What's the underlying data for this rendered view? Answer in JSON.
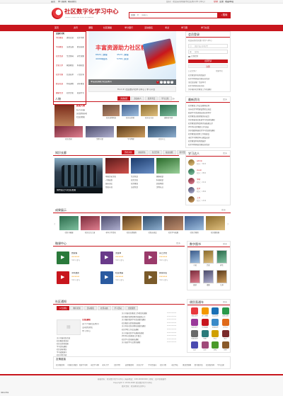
{
  "topbar": {
    "links": [
      "首页",
      "学习指南",
      "联系我们"
    ],
    "right": "您好！欢迎来到成都市社区教育学习中心！",
    "login": "登录",
    "register": "注册",
    "fav": "收藏本站"
  },
  "logo": {
    "title": "社区数字化学习中心",
    "sub": "SHEQU SHUZIHUA XUEXI ZHONGXIN"
  },
  "search": {
    "category": "全部",
    "value": "请输入",
    "button": "搜索"
  },
  "nav": [
    "首页",
    "资讯",
    "课程",
    "社区展播",
    "学分银行",
    "活动报名",
    "考试",
    "学习圈",
    "学习社区"
  ],
  "category": {
    "title": "全部分类",
    "groups": [
      "学历教育",
      "理论宣讲",
      "社区书院",
      "学前教育",
      "法律法规",
      "职业技能",
      "社区活动",
      "生活休闲",
      "养生保健",
      "文化艺术",
      "家庭教育",
      "科普知识",
      "社区专题",
      "信息技术",
      "人文社科",
      "职业培训",
      "特色课程",
      "老年教育",
      "健康生活",
      "社区文化",
      "终身学习"
    ]
  },
  "banner": {
    "headline": "丰富资源助力社区教育",
    "stats": [
      "6621门课程",
      "4527门课程",
      "4006本图书",
      "5783门资源"
    ],
    "caption": "丰富资源助力社区教育",
    "dots": [
      "1",
      "2",
      "3",
      "4",
      "5"
    ]
  },
  "promo_bar": "Find it! 社区数字化学习中心 | 学习平台",
  "login_box": {
    "title": "会员登录",
    "welcome": "欢迎来到社区数字化学习中心",
    "fields": [
      "用户名/手机号",
      "密码"
    ],
    "remember": "记住密码",
    "login_btn": "立即登录",
    "register_btn": "注册",
    "links": [
      "忘记密码？",
      "帮助中心"
    ]
  },
  "people": {
    "title": "人物",
    "tabs": [
      "道德模范",
      "身边好人",
      "优秀学员",
      "学习之星"
    ],
    "feature": {
      "name": "新闻人物",
      "lines": [
        "好人好事",
        "身边的感动",
        "社区楷模"
      ]
    },
    "thumbs": [
      "社区讲师风采",
      "社区志愿者",
      "社区文艺队",
      "退休老干部",
      "社区活动",
      "邻里守望",
      "学习明星",
      "社区义工"
    ],
    "more": "更多"
  },
  "news": {
    "title": "最新资讯",
    "more": "更多",
    "items": [
      "社区教育工作会议顺利召开",
      "全市社区学院建设经验交流会",
      "终身学习活动周启动仪式举行",
      "社区教育志愿者服务队成立",
      "关于开展全民终身学习活动的通知",
      "社区教育优秀案例评选结果公示",
      "2016年社区教育工作总结",
      "关于组织开展社区学习活动的通知",
      "社区教育实验区工作推进会",
      "市民学习体验中心建设启动",
      "社区教育特色项目展示",
      "社区学院开展主题宣讲活动",
      "全民阅读推广活动举行",
      "社区书院开放日活动",
      "关于做好社区教育工作的通知"
    ]
  },
  "knowledge": {
    "title": "知识长廊",
    "tabs": [
      "历史文化",
      "健康养生",
      "生活百科",
      "职业技能",
      "科学普及"
    ],
    "caption": "城市变迁与社区发展",
    "items": [
      "中国历史文化",
      "人物故事",
      "城市记忆",
      "传统节日",
      "生活常识",
      "社区文化",
      "社区教育",
      "法律常识",
      "健康知识",
      "科普知识",
      "民俗风情",
      "文明礼仪"
    ],
    "more": "更多"
  },
  "learners": {
    "title": "学习达人",
    "more": "更多",
    "items": [
      {
        "name": "admin",
        "score": "积分：3620"
      },
      {
        "name": "xuexi",
        "score": "积分：2860"
      },
      {
        "name": "李明",
        "score": "积分：2210"
      },
      {
        "name": "张华",
        "score": "积分：1890"
      },
      {
        "name": "王芳",
        "score": "积分：1530"
      }
    ]
  },
  "showcase": {
    "title": "成果展示",
    "more": "更多",
    "items": [
      "社区书画展",
      "社区文艺汇演",
      "老年大学活动",
      "社区志愿服务",
      "社区运动会",
      "社区学习成果",
      "社区合唱团",
      "社区摄影展"
    ]
  },
  "courses": {
    "title": "微课中心",
    "more": "更多",
    "items": [
      {
        "name": "微课程",
        "rating": "★★★★★",
        "count": "342人参与",
        "color": "#2a7a3b"
      },
      {
        "name": "太极拳",
        "rating": "★★★★★",
        "count": "342人参与",
        "color": "#6a3a8a"
      },
      {
        "name": "茶艺文化",
        "rating": "★★★★★",
        "count": "342人参与",
        "color": "#9a3a6a"
      },
      {
        "name": "手机摄影",
        "rating": "★★★★★",
        "count": "342人参与",
        "color": "#c8161d"
      },
      {
        "name": "社区舞蹈",
        "rating": "★★★★★",
        "count": "342人参与",
        "color": "#2a5aa0"
      },
      {
        "name": "健康养生",
        "rating": "★★★★★",
        "count": "342人参与",
        "color": "#7a5a2a"
      }
    ]
  },
  "books": {
    "title": "数字图书",
    "more": "更多",
    "items": [
      "小说",
      "历史",
      "养生",
      "旅游",
      "摄影",
      "艺术"
    ]
  },
  "notice": {
    "title": "社区通知",
    "tabs": [
      "公告通知",
      "教育培训",
      "活动报名",
      "社区动态",
      "学习活动",
      "志愿服务"
    ],
    "feature_title": "公告通知",
    "feature_lines": [
      "关于开展社区教育",
      "活动的通知",
      "学习中心"
    ],
    "items": [
      {
        "t": "关于开展社区教育工作检查的通知",
        "d": "2016-06-06"
      },
      {
        "t": "社区教育优秀案例评选结果公示",
        "d": "2016-06-06"
      },
      {
        "t": "关于做好终身学习活动周的通知",
        "d": "2016-06-06"
      },
      {
        "t": "社区教育志愿者招募通知",
        "d": "2016-06-06"
      },
      {
        "t": "关于举办社区讲师培训班的通知",
        "d": "2016-06-06"
      },
      {
        "t": "社区学院工作会议通知",
        "d": "2016-06-06"
      },
      {
        "t": "关于开展社区学习调研的通知",
        "d": "2016-06-06"
      },
      {
        "t": "2016年社区教育工作要点",
        "d": "2016-06-06"
      },
      {
        "t": "社区学习活动报名通知",
        "d": "2016-06-06"
      },
      {
        "t": "关于表彰学习之星的通知",
        "d": "2016-06-06"
      }
    ],
    "col2": [
      "关于开展社区活动",
      "社区教育周活动",
      "社区志愿者招募",
      "学习活动通知",
      "社区讲座预告",
      "学习成果展示",
      "社区书院开放",
      "终身学习推广",
      "社区培训通知",
      "社区文化节"
    ]
  },
  "apps": {
    "title": "便民直通车",
    "more": "更多",
    "items": [
      "便民查询",
      "天气预报",
      "公交查询",
      "违章查询",
      "医院挂号",
      "水电缴费",
      "快递查询",
      "火车票",
      "航班查询",
      "地图",
      "彩票",
      "股票",
      "日历",
      "音乐",
      "游戏",
      "新闻"
    ]
  },
  "links": {
    "title": "友情链接",
    "items": [
      "社区教育网",
      "中国社区教育",
      "终身学习网",
      "市民学习网",
      "老年大学",
      "社区学院",
      "远程教育网",
      "开放大学",
      "学习型城市",
      "社区书院",
      "市民学校",
      "教育资源网",
      "数字图书馆",
      "社区服务网",
      "学习之家"
    ]
  },
  "footer": {
    "lines": [
      "版权所有：社区数字化学习中心 | 联系电话：028-00000000 | 地址：四川省成都市",
      "Copyright © 2016-2020 社区数字化学习中心",
      "技术支持：社区教育信息中心"
    ]
  },
  "corner": "389×559"
}
